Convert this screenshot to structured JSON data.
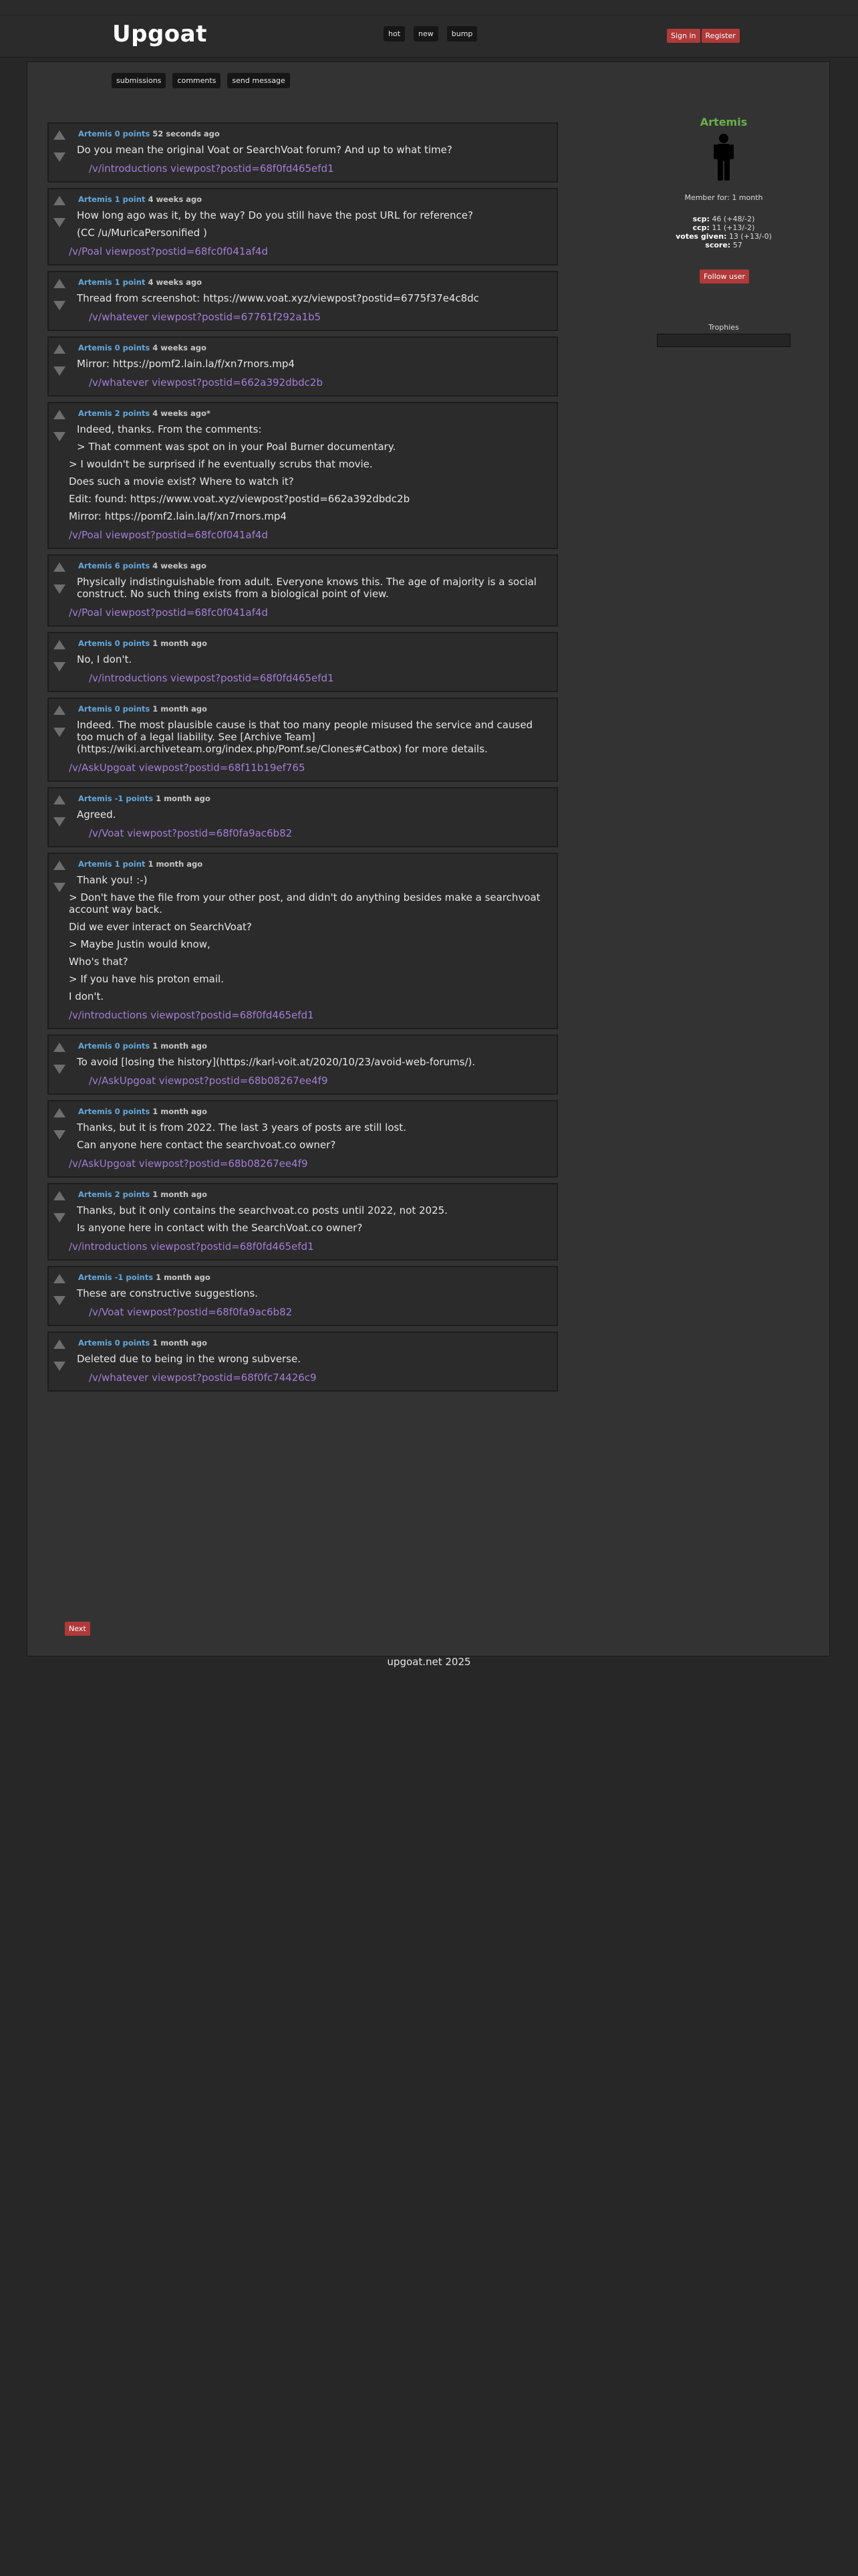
{
  "site": {
    "logo": "Upgoat",
    "footer": "upgoat.net 2025"
  },
  "nav": {
    "hot": "hot",
    "new": "new",
    "bump": "bump"
  },
  "auth": {
    "sign_in": "Sign in",
    "register": "Register"
  },
  "user_tabs": {
    "submissions": "submissions",
    "comments": "comments",
    "send_message": "send message"
  },
  "profile": {
    "username": "Artemis",
    "member_for": "Member for: 1 month",
    "scp_label": "scp:",
    "scp_value": "46 (+48/-2)",
    "ccp_label": "ccp:",
    "ccp_value": "11 (+13/-2)",
    "votes_label": "votes given:",
    "votes_value": "13 (+13/-0)",
    "score_label": "score:",
    "score_value": "57",
    "follow": "Follow user",
    "trophies": "Trophies",
    "name_color": "#6ab04c"
  },
  "comments": [
    {
      "author": "Artemis",
      "points": "0 points",
      "time": "52 seconds ago",
      "lines": [
        {
          "t": "Do you mean the original Voat or SearchVoat forum? And up to what time?",
          "i": 1
        }
      ],
      "link": "/v/introductions viewpost?postid=68f0fd465efd1",
      "li": 1
    },
    {
      "author": "Artemis",
      "points": "1 point",
      "time": "4 weeks ago",
      "lines": [
        {
          "t": "How long ago was it, by the way? Do you still have the post URL for reference?",
          "i": 1
        },
        {
          "t": "(CC /u/MuricaPersonified )",
          "i": 1
        }
      ],
      "link": "/v/Poal viewpost?postid=68fc0f041af4d",
      "li": 0
    },
    {
      "author": "Artemis",
      "points": "1 point",
      "time": "4 weeks ago",
      "lines": [
        {
          "t": "Thread from screenshot: https://www.voat.xyz/viewpost?postid=6775f37e4c8dc",
          "i": 1
        }
      ],
      "link": "/v/whatever viewpost?postid=67761f292a1b5",
      "li": 1
    },
    {
      "author": "Artemis",
      "points": "0 points",
      "time": "4 weeks ago",
      "lines": [
        {
          "t": "Mirror: https://pomf2.lain.la/f/xn7rnors.mp4",
          "i": 1
        }
      ],
      "link": "/v/whatever viewpost?postid=662a392dbdc2b",
      "li": 1
    },
    {
      "author": "Artemis",
      "points": "2 points",
      "time": "4 weeks ago*",
      "lines": [
        {
          "t": "Indeed, thanks. From the comments:",
          "i": 1
        },
        {
          "t": "> That comment was spot on in your Poal Burner documentary.",
          "i": 1
        },
        {
          "t": "> I wouldn't be surprised if he eventually scrubs that movie.",
          "i": 0
        },
        {
          "t": "Does such a movie exist? Where to watch it?",
          "i": 0
        },
        {
          "t": "Edit: found: https://www.voat.xyz/viewpost?postid=662a392dbdc2b",
          "i": 0
        },
        {
          "t": "Mirror: https://pomf2.lain.la/f/xn7rnors.mp4",
          "i": 0
        }
      ],
      "link": "/v/Poal viewpost?postid=68fc0f041af4d",
      "li": 0
    },
    {
      "author": "Artemis",
      "points": "6 points",
      "time": "4 weeks ago",
      "lines": [
        {
          "t": "Physically indistinguishable from adult. Everyone knows this. The age of majority is a social construct. No such thing exists from a biological point of view.",
          "i": 1
        }
      ],
      "link": "/v/Poal viewpost?postid=68fc0f041af4d",
      "li": 0
    },
    {
      "author": "Artemis",
      "points": "0 points",
      "time": "1 month ago",
      "lines": [
        {
          "t": "No, I don't.",
          "i": 1
        }
      ],
      "link": "/v/introductions viewpost?postid=68f0fd465efd1",
      "li": 1
    },
    {
      "author": "Artemis",
      "points": "0 points",
      "time": "1 month ago",
      "lines": [
        {
          "t": "Indeed. The most plausible cause is that too many people misused the service and caused too much of a legal liability. See [Archive Team](https://wiki.archiveteam.org/index.php/Pomf.se/Clones#Catbox) for more details.",
          "i": 1
        }
      ],
      "link": "/v/AskUpgoat viewpost?postid=68f11b19ef765",
      "li": 0
    },
    {
      "author": "Artemis",
      "points": "-1 points",
      "time": "1 month ago",
      "lines": [
        {
          "t": "Agreed.",
          "i": 1
        }
      ],
      "link": "/v/Voat viewpost?postid=68f0fa9ac6b82",
      "li": 1
    },
    {
      "author": "Artemis",
      "points": "1 point",
      "time": "1 month ago",
      "lines": [
        {
          "t": "Thank you! :-)",
          "i": 1
        },
        {
          "t": "> Don't have the file from your other post, and didn't do anything besides make a searchvoat account way back.",
          "i": 0
        },
        {
          "t": "Did we ever interact on SearchVoat?",
          "i": 0
        },
        {
          "t": "> Maybe Justin would know,",
          "i": 0
        },
        {
          "t": "Who's that?",
          "i": 0
        },
        {
          "t": "> If you have his proton email.",
          "i": 0
        },
        {
          "t": "I don't.",
          "i": 0
        }
      ],
      "link": "/v/introductions viewpost?postid=68f0fd465efd1",
      "li": 0
    },
    {
      "author": "Artemis",
      "points": "0 points",
      "time": "1 month ago",
      "lines": [
        {
          "t": "To avoid [losing the history](https://karl-voit.at/2020/10/23/avoid-web-forums/).",
          "i": 1
        }
      ],
      "link": "/v/AskUpgoat viewpost?postid=68b08267ee4f9",
      "li": 1
    },
    {
      "author": "Artemis",
      "points": "0 points",
      "time": "1 month ago",
      "lines": [
        {
          "t": "Thanks, but it is from 2022. The last 3 years of posts are still lost.",
          "i": 1
        },
        {
          "t": "Can anyone here contact the searchvoat.co owner?",
          "i": 1
        }
      ],
      "link": "/v/AskUpgoat viewpost?postid=68b08267ee4f9",
      "li": 0
    },
    {
      "author": "Artemis",
      "points": "2 points",
      "time": "1 month ago",
      "lines": [
        {
          "t": "Thanks, but it only contains the searchvoat.co posts until 2022, not 2025.",
          "i": 1
        },
        {
          "t": "Is anyone here in contact with the SearchVoat.co owner?",
          "i": 1
        }
      ],
      "link": "/v/introductions viewpost?postid=68f0fd465efd1",
      "li": 0
    },
    {
      "author": "Artemis",
      "points": "-1 points",
      "time": "1 month ago",
      "lines": [
        {
          "t": "These are constructive suggestions.",
          "i": 1
        }
      ],
      "link": "/v/Voat viewpost?postid=68f0fa9ac6b82",
      "li": 1
    },
    {
      "author": "Artemis",
      "points": "0 points",
      "time": "1 month ago",
      "lines": [
        {
          "t": "Deleted due to being in the wrong subverse.",
          "i": 1
        }
      ],
      "link": "/v/whatever viewpost?postid=68f0fc74426c9",
      "li": 1
    }
  ],
  "pagination": {
    "next": "Next"
  },
  "colors": {
    "background": "#272727",
    "panel": "#333333",
    "accent_red": "#b03a3a",
    "link_purple": "#a47ed6",
    "author_blue": "#63a8dd"
  }
}
